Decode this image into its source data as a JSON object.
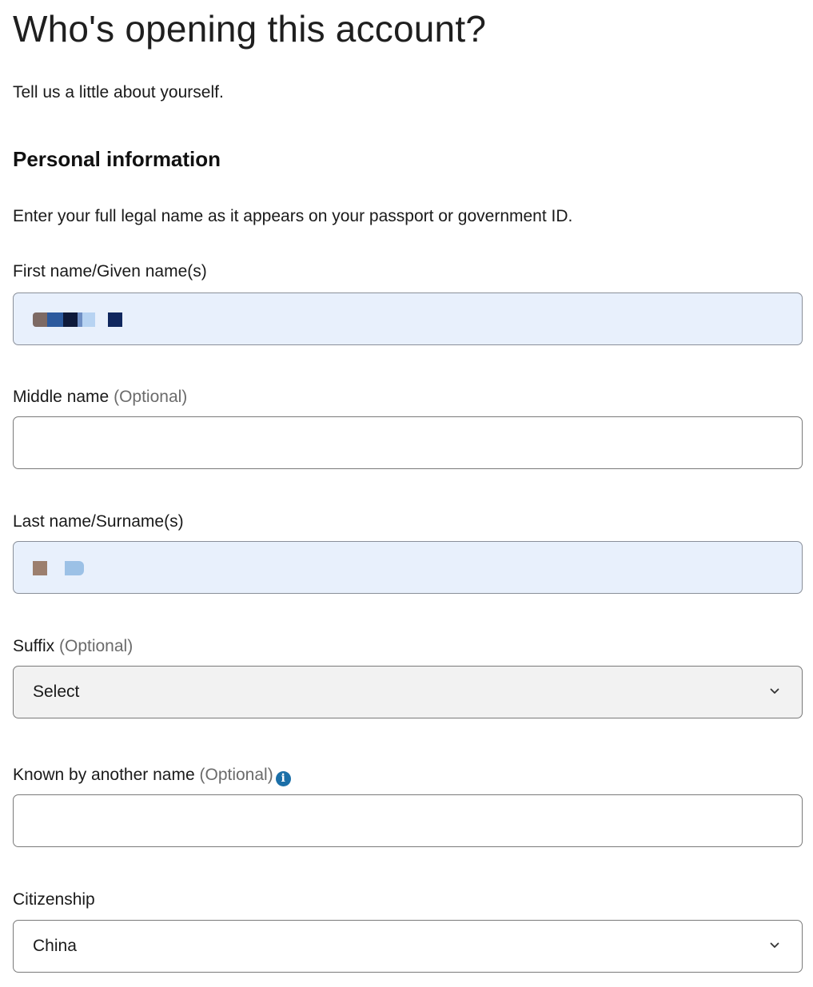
{
  "page": {
    "title": "Who's opening this account?",
    "subtitle": "Tell us a little about yourself.",
    "section_heading": "Personal information",
    "instructions": "Enter your full legal name as it appears on your passport or government ID."
  },
  "fields": {
    "first_name": {
      "label": "First name/Given name(s)",
      "value_redacted": true
    },
    "middle_name": {
      "label": "Middle name",
      "optional_tag": "(Optional)",
      "value": ""
    },
    "last_name": {
      "label": "Last name/Surname(s)",
      "value_redacted": true
    },
    "suffix": {
      "label": "Suffix",
      "optional_tag": "(Optional)",
      "selected": "Select"
    },
    "known_by": {
      "label": "Known by another name",
      "optional_tag": "(Optional)",
      "info_icon": "info-icon",
      "value": ""
    },
    "citizenship": {
      "label": "Citizenship",
      "selected": "China"
    }
  },
  "colors": {
    "autofill_background": "#e8f0fc",
    "select_background": "#f2f2f2",
    "info_icon": "#1b6fa8",
    "optional_text": "#6b6b6b"
  }
}
